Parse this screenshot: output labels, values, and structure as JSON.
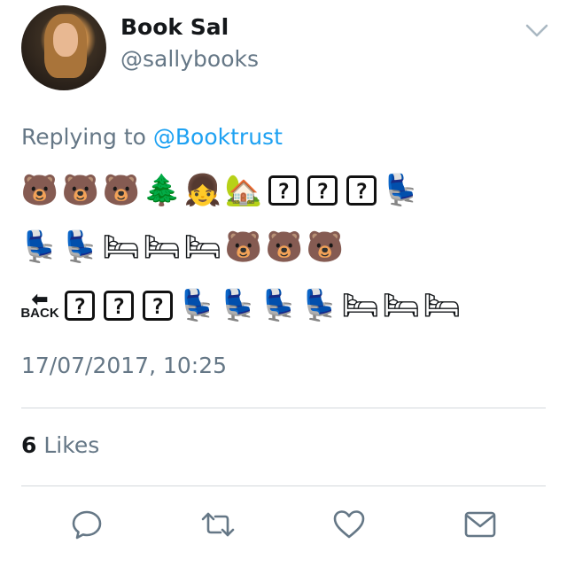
{
  "tweet": {
    "display_name": "Book Sal",
    "handle": "@sallybooks",
    "replying_prefix": "Replying to",
    "replying_mention": "@Booktrust",
    "emoji_lines": [
      [
        "🐻",
        "🐻",
        "🐻",
        "🌲",
        "👧",
        "🏡",
        "?",
        "?",
        "?",
        "💺"
      ],
      [
        "💺",
        "💺",
        "🛏",
        "🛏",
        "🛏",
        "🐻",
        "🐻",
        "🐻"
      ],
      [
        "🔙",
        "?",
        "?",
        "?",
        "💺",
        "💺",
        "💺",
        "💺",
        "🛏",
        "🛏",
        "🛏"
      ]
    ],
    "back_label": "BACK",
    "timestamp": "17/07/2017, 10:25",
    "likes_count": "6",
    "likes_label": "Likes"
  },
  "actions": {
    "icons": [
      "reply-icon",
      "retweet-icon",
      "like-icon",
      "direct-message-icon"
    ]
  },
  "colors": {
    "accent": "#1da1f2",
    "secondary_text": "#657786",
    "primary_text": "#14171a",
    "divider": "#d3d8dc"
  }
}
